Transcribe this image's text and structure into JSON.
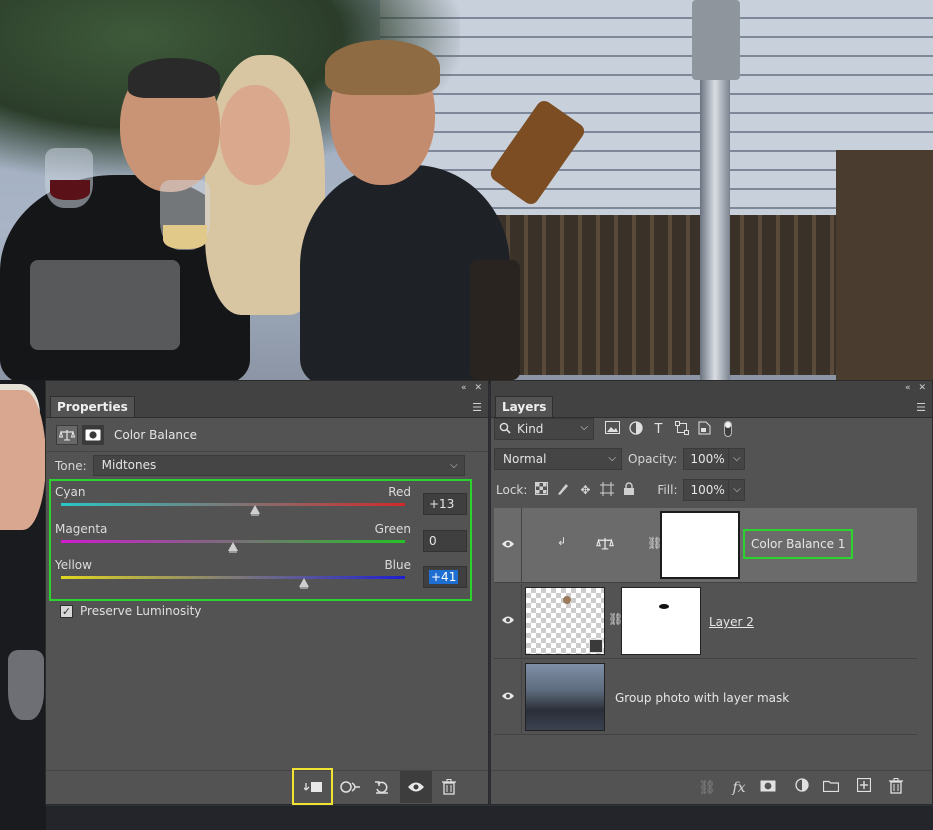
{
  "panels_collapse_glyph": "«",
  "properties": {
    "tab": "Properties",
    "adjustment_title": "Color Balance",
    "tone_label": "Tone:",
    "tone_value": "Midtones",
    "sliders": [
      {
        "left": "Cyan",
        "right": "Red",
        "value": "+13",
        "thumb_fraction": 0.565,
        "gradient": [
          "#29c6c6",
          "#d02a2a"
        ]
      },
      {
        "left": "Magenta",
        "right": "Green",
        "value": "0",
        "thumb_fraction": 0.5,
        "gradient": [
          "#d01ad0",
          "#25c125"
        ]
      },
      {
        "left": "Yellow",
        "right": "Blue",
        "value": "+41",
        "thumb_fraction": 0.705,
        "gradient": [
          "#e0d620",
          "#1f1fd0"
        ]
      }
    ],
    "preserve_label": "Preserve Luminosity",
    "preserve_checked": true,
    "footer_icons": [
      "clip-to-layer-icon",
      "view-previous-icon",
      "reset-icon",
      "visibility-icon",
      "trash-icon"
    ]
  },
  "layers": {
    "tab": "Layers",
    "filter_kind": "Kind",
    "blend_mode": "Normal",
    "opacity_label": "Opacity:",
    "opacity": "100%",
    "lock_label": "Lock:",
    "fill_label": "Fill:",
    "fill": "100%",
    "list": [
      {
        "name": "Color Balance 1",
        "type": "adjustment",
        "selected": true
      },
      {
        "name": "Layer 2",
        "type": "pixel-with-mask",
        "selected": false
      },
      {
        "name": "Group photo with layer mask",
        "type": "photo",
        "selected": false
      }
    ],
    "footer_icons": [
      "link-icon",
      "fx-icon",
      "add-mask-icon",
      "adjustment-icon",
      "folder-icon",
      "new-layer-icon",
      "trash-icon"
    ]
  },
  "colors": {
    "highlight_green": "#2ed22e",
    "highlight_yellow": "#f1e332",
    "selection_blue": "#1f6fd3"
  }
}
